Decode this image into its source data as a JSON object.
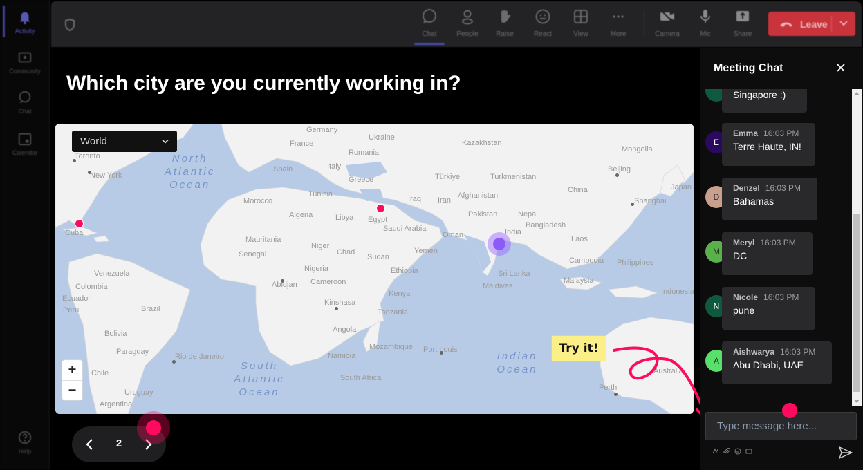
{
  "rail": {
    "items": [
      {
        "label": "Activity",
        "icon": "bell-icon",
        "active": true
      },
      {
        "label": "Community",
        "icon": "community-icon",
        "active": false
      },
      {
        "label": "Chat",
        "icon": "chat-icon",
        "active": false
      },
      {
        "label": "Calendar",
        "icon": "calendar-icon",
        "active": false
      },
      {
        "label": "Help",
        "icon": "help-icon",
        "active": false
      }
    ]
  },
  "toolbar": {
    "buttons": [
      {
        "label": "Chat",
        "icon": "chat-icon",
        "active": true
      },
      {
        "label": "People",
        "icon": "people-icon"
      },
      {
        "label": "Raise",
        "icon": "raise-hand-icon"
      },
      {
        "label": "React",
        "icon": "react-icon"
      },
      {
        "label": "View",
        "icon": "view-grid-icon"
      },
      {
        "label": "More",
        "icon": "more-icon"
      },
      {
        "label": "Camera",
        "icon": "camera-off-icon"
      },
      {
        "label": "Mic",
        "icon": "mic-icon"
      },
      {
        "label": "Share",
        "icon": "share-icon"
      }
    ],
    "leave_label": "Leave",
    "leave_color": "#c9343c"
  },
  "stage": {
    "question": "Which city are you currently working in?",
    "region_select": "World",
    "zoom_in": "+",
    "zoom_out": "−",
    "try_it": "Try it!",
    "page_number": "2"
  },
  "map": {
    "oceans": [
      "North Atlantic Ocean",
      "South Atlantic Ocean",
      "Indian Ocean"
    ],
    "labels": [
      "Toronto",
      "New York",
      "Cuba",
      "Germany",
      "Ukraine",
      "Kazakhstan",
      "Mongolia",
      "France",
      "Romania",
      "Spain",
      "Italy",
      "Greece",
      "Türkiye",
      "Turkmenistan",
      "Beijing",
      "Japan",
      "China",
      "Shanghai",
      "Morocco",
      "Tunisia",
      "Algeria",
      "Libya",
      "Egypt",
      "Iraq",
      "Iran",
      "Afghanistan",
      "Pakistan",
      "Nepal",
      "India",
      "Bangladesh",
      "Saudi Arabia",
      "Oman",
      "Yemen",
      "Laos",
      "Mauritania",
      "Senegal",
      "Niger",
      "Chad",
      "Sudan",
      "Nigeria",
      "Ethiopia",
      "Cambodia",
      "Philippines",
      "Venezuela",
      "Colombia",
      "Ecuador",
      "Abidjan",
      "Cameroon",
      "Kenya",
      "Sri Lanka",
      "Maldives",
      "Malaysia",
      "Kinshasa",
      "Tanzania",
      "Indonesia",
      "Peru",
      "Brazil",
      "Bolivia",
      "Angola",
      "Rio de Janeiro",
      "Paraguay",
      "Chile",
      "Namibia",
      "Mozambique",
      "Port Louis",
      "South Africa",
      "Uruguay",
      "Argentina",
      "Australia",
      "Perth"
    ],
    "pin_color": "#ff0a5f",
    "highlight_color": "#8c5af7"
  },
  "chat": {
    "title": "Meeting Chat",
    "messages": [
      {
        "initial": "",
        "name": "",
        "time": "",
        "text": "Singapore :)",
        "avatar_color": "#0f5a3e"
      },
      {
        "initial": "E",
        "name": "Emma",
        "time": "16:03 PM",
        "text": "Terre Haute, IN!",
        "avatar_color": "#2a0a5e"
      },
      {
        "initial": "D",
        "name": "Denzel",
        "time": "16:03 PM",
        "text": "Bahamas",
        "avatar_color": "#c9a08e"
      },
      {
        "initial": "M",
        "name": "Meryl",
        "time": "16:03 PM",
        "text": "DC",
        "avatar_color": "#5ab04a"
      },
      {
        "initial": "N",
        "name": "Nicole",
        "time": "16:03 PM",
        "text": "pune",
        "avatar_color": "#0f5a3e"
      },
      {
        "initial": "A",
        "name": "Aishwarya",
        "time": "16:03 PM",
        "text": "Abu Dhabi, UAE",
        "avatar_color": "#57e06a"
      }
    ],
    "compose_placeholder": "Type message here..."
  }
}
